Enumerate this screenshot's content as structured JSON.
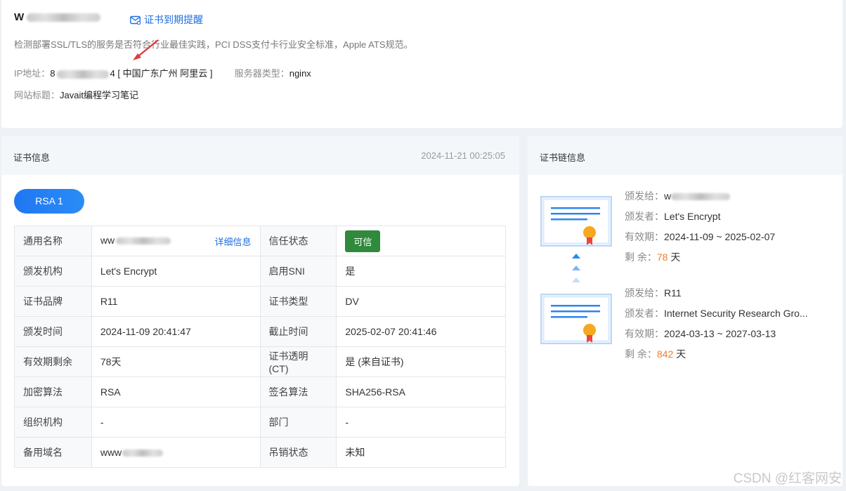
{
  "site": {
    "name_prefix": "W",
    "remind_label": "证书到期提醒",
    "description": "检测部署SSL/TLS的服务是否符合行业最佳实践，PCI DSS支付卡行业安全标准，Apple ATS规范。",
    "ip_label": "IP地址：",
    "ip_prefix": "8",
    "ip_suffix": "4",
    "ip_location": "[ 中国广东广州 阿里云 ]",
    "server_label": "服务器类型：",
    "server_value": "nginx",
    "title_label": "网站标题：",
    "title_value": "Javait编程学习笔记"
  },
  "cert": {
    "header_title": "证书信息",
    "header_date": "2024-11-21 00:25:05",
    "tab_label": "RSA 1",
    "detail_link": "详细信息",
    "rows": [
      {
        "k1": "通用名称",
        "v1": "ww",
        "k2": "信任状态",
        "v2": "可信"
      },
      {
        "k1": "颁发机构",
        "v1": "Let's Encrypt",
        "k2": "启用SNI",
        "v2": "是"
      },
      {
        "k1": "证书品牌",
        "v1": "R11",
        "k2": "证书类型",
        "v2": "DV"
      },
      {
        "k1": "颁发时间",
        "v1": "2024-11-09 20:41:47",
        "k2": "截止时间",
        "v2": "2025-02-07 20:41:46"
      },
      {
        "k1": "有效期剩余",
        "v1": "78天",
        "k2": "证书透明(CT)",
        "v2": "是 (来自证书)"
      },
      {
        "k1": "加密算法",
        "v1": "RSA",
        "k2": "签名算法",
        "v2": "SHA256-RSA"
      },
      {
        "k1": "组织机构",
        "v1": "-",
        "k2": "部门",
        "v2": "-"
      },
      {
        "k1": "备用域名",
        "v1": "www",
        "k2": "吊销状态",
        "v2": "未知"
      }
    ]
  },
  "chain": {
    "header_title": "证书链信息",
    "items": [
      {
        "issued_to_label": "颁发给：",
        "issued_to": "w",
        "issuer_label": "颁发者：",
        "issuer": "Let's Encrypt",
        "validity_label": "有效期：",
        "validity": "2024-11-09 ~ 2025-02-07",
        "remain_label": "剩 余：",
        "remain_value": "78",
        "remain_unit": "天"
      },
      {
        "issued_to_label": "颁发给：",
        "issued_to": "R11",
        "issuer_label": "颁发者：",
        "issuer": "Internet Security Research Gro...",
        "validity_label": "有效期：",
        "validity": "2024-03-13 ~ 2027-03-13",
        "remain_label": "剩 余：",
        "remain_value": "842",
        "remain_unit": "天"
      }
    ]
  },
  "watermark": "CSDN @红客网安",
  "colors": {
    "accent": "#1f6fde",
    "trusted": "#2f8a3c",
    "remain": "#f07b2b"
  }
}
